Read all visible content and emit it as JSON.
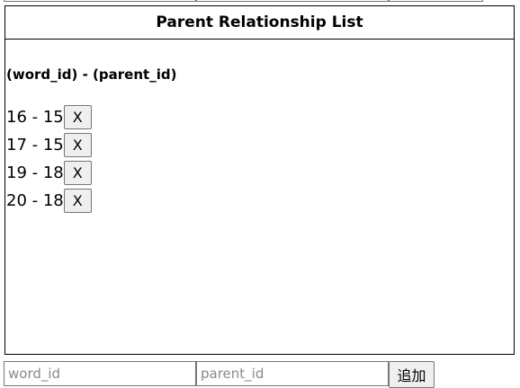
{
  "panel": {
    "title": "Parent Relationship List",
    "column_header": "(word_id) - (parent_id)"
  },
  "relationships": [
    {
      "word_id": "16",
      "parent_id": "15",
      "label": "16 - 15",
      "delete_label": "X"
    },
    {
      "word_id": "17",
      "parent_id": "15",
      "label": "17 - 15",
      "delete_label": "X"
    },
    {
      "word_id": "19",
      "parent_id": "18",
      "label": "19 - 18",
      "delete_label": "X"
    },
    {
      "word_id": "20",
      "parent_id": "18",
      "label": "20 - 18",
      "delete_label": "X"
    }
  ],
  "form": {
    "word_id_placeholder": "word_id",
    "word_id_value": "",
    "parent_id_placeholder": "parent_id",
    "parent_id_value": "",
    "add_label": "追加"
  }
}
